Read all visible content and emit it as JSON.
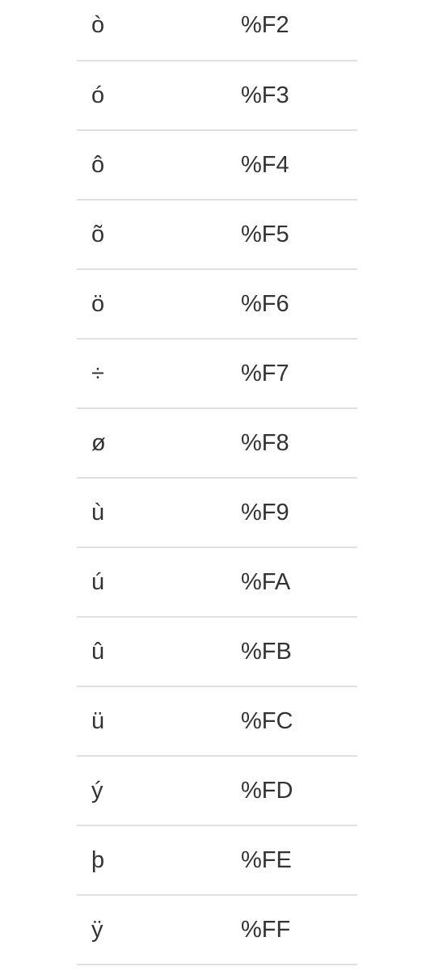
{
  "rows": [
    {
      "character": "ò",
      "encoding": "%F2"
    },
    {
      "character": "ó",
      "encoding": "%F3"
    },
    {
      "character": "ô",
      "encoding": "%F4"
    },
    {
      "character": "õ",
      "encoding": "%F5"
    },
    {
      "character": "ö",
      "encoding": "%F6"
    },
    {
      "character": "÷",
      "encoding": "%F7"
    },
    {
      "character": "ø",
      "encoding": "%F8"
    },
    {
      "character": "ù",
      "encoding": "%F9"
    },
    {
      "character": "ú",
      "encoding": "%FA"
    },
    {
      "character": "û",
      "encoding": "%FB"
    },
    {
      "character": "ü",
      "encoding": "%FC"
    },
    {
      "character": "ý",
      "encoding": "%FD"
    },
    {
      "character": "þ",
      "encoding": "%FE"
    },
    {
      "character": "ÿ",
      "encoding": "%FF"
    }
  ]
}
